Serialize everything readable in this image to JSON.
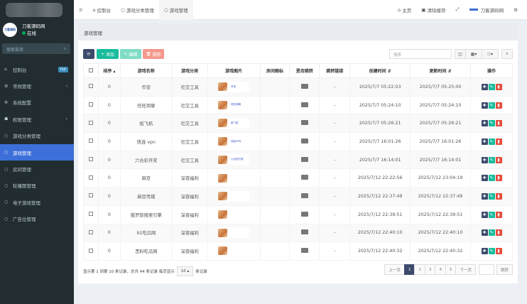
{
  "brand": {
    "name": "刀客源码网",
    "avatar_text": "刀客源码",
    "status": "在线"
  },
  "sidebar": {
    "search_placeholder": "搜索菜单",
    "items": [
      {
        "label": "控制台",
        "icon": "dashboard-icon",
        "badge": "hot"
      },
      {
        "label": "常规管理",
        "icon": "cogs-icon",
        "arrow": true
      },
      {
        "label": "系统配置",
        "icon": "gear-icon"
      },
      {
        "label": "权限管理",
        "icon": "group-icon",
        "arrow": true
      },
      {
        "label": "游戏分类管理",
        "icon": "circle-icon"
      },
      {
        "label": "游戏管理",
        "icon": "circle-icon",
        "active": true
      },
      {
        "label": "房间管理",
        "icon": "circle-icon"
      },
      {
        "label": "轮播图管理",
        "icon": "circle-icon"
      },
      {
        "label": "电子游戏管理",
        "icon": "circle-icon"
      },
      {
        "label": "广告位管理",
        "icon": "circle-icon"
      }
    ]
  },
  "topbar": {
    "tabs": [
      "控制台",
      "游戏分类管理",
      "游戏管理"
    ],
    "home": "主页",
    "clear_cache": "清除缓存",
    "user": "刀客源码网"
  },
  "page": {
    "heading": "游戏管理",
    "add": "添加",
    "edit": "编辑",
    "delete": "删除",
    "search_placeholder": "搜索"
  },
  "table": {
    "headers": [
      "排序",
      "游戏名称",
      "游戏分类",
      "游戏图片",
      "房间图标",
      "是否跳转",
      "跳转链接",
      "创建时间",
      "更新时间",
      "操作"
    ],
    "rows": [
      [
        "0",
        "币安",
        "社交工具",
        "币安",
        "",
        "-",
        "2025/7/7 05:22:03",
        "2025/7/7 05:25:00"
      ],
      [
        "0",
        "旺旺商聊",
        "社交工具",
        "旺旺商聊",
        "",
        "-",
        "2025/7/7 05:24:10",
        "2025/7/7 05:24:10"
      ],
      [
        "0",
        "纸飞机",
        "社交工具",
        "纸飞机",
        "",
        "-",
        "2025/7/7 05:26:21",
        "2025/7/7 05:26:21"
      ],
      [
        "0",
        "快连 vpn",
        "社交工具",
        "快连VPN",
        "",
        "-",
        "2025/7/7 16:01:26",
        "2025/7/7 16:01:26"
      ],
      [
        "0",
        "六合彩开奖",
        "社交工具",
        "六合彩开奖",
        "",
        "-",
        "2025/7/7 16:14:01",
        "2025/7/7 16:14:01"
      ],
      [
        "0",
        "麻豆",
        "深夜福利",
        "",
        "",
        "-",
        "2025/7/12 22:22:56",
        "2025/7/12 23:04:19"
      ],
      [
        "0",
        "麻豆传媒",
        "深夜福利",
        "",
        "",
        "-",
        "2025/7/12 22:37:49",
        "2025/7/12 22:37:49"
      ],
      [
        "0",
        "俄罗斯搜索引擎",
        "深夜福利",
        "",
        "",
        "-",
        "2025/7/12 22:39:51",
        "2025/7/12 22:39:51"
      ],
      [
        "0",
        "91吃瓜网",
        "深夜福利",
        "",
        "",
        "-",
        "2025/7/12 22:40:10",
        "2025/7/12 22:40:10"
      ],
      [
        "0",
        "黑料吃瓜网",
        "深夜福利",
        "",
        "",
        "-",
        "2025/7/12 22:40:32",
        "2025/7/12 22:40:32"
      ]
    ]
  },
  "pagination": {
    "info": "显示第 1 到第 10 条记录，总共 44 条记录 每页显示",
    "page_size": "10",
    "suffix": "条记录",
    "prev": "上一页",
    "pages": [
      "1",
      "2",
      "3",
      "4",
      "5"
    ],
    "current": "1",
    "next": "下一页",
    "jump": "跳转"
  },
  "colors": {
    "sidebar": "#222d32",
    "active": "#3c6fd8",
    "add": "#18bc9c",
    "edit": "#6fd8c0",
    "delete": "#f08a7e",
    "refresh": "#3c4a6c"
  }
}
